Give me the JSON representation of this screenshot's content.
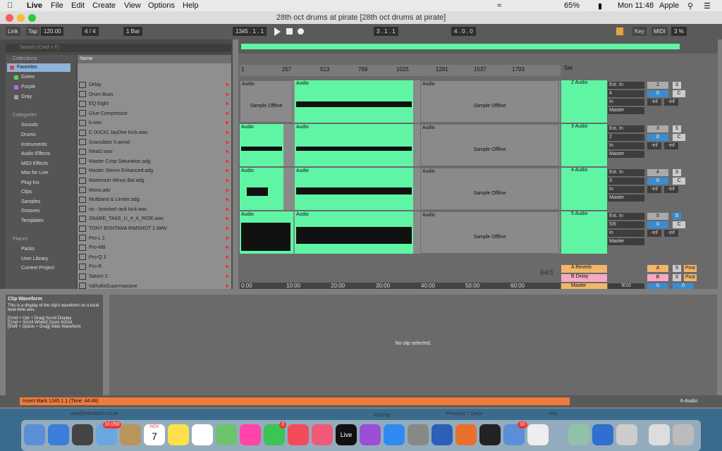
{
  "menubar": {
    "app": "Live",
    "menus": [
      "File",
      "Edit",
      "Create",
      "View",
      "Options",
      "Help"
    ],
    "battery": "65%",
    "clock": "Mon 11:48",
    "user": "Apple"
  },
  "window": {
    "title": "28th oct drums at pirate  [28th oct drums at pirate]"
  },
  "control": {
    "link": "Link",
    "tap": "Tap",
    "tempo": "120.00",
    "signature": "4 / 4",
    "quantize": "1 Bar",
    "position": "1345 .  1 .  1",
    "loop_start": "3 .  1 .  1",
    "loop_len": "4 .  0 .  0",
    "key": "Key",
    "midi": "MIDI",
    "cpu": "3 %"
  },
  "browser": {
    "search_placeholder": "Search (Cmd + F)",
    "collections_title": "Collections",
    "collections": [
      {
        "label": "Favorites",
        "color": "#e84040"
      },
      {
        "label": "Green",
        "color": "#5ad35a"
      },
      {
        "label": "Purple",
        "color": "#b46ae0"
      },
      {
        "label": "Gray",
        "color": "#a0a0a0"
      }
    ],
    "categories_title": "Categories",
    "categories": [
      "Sounds",
      "Drums",
      "Instruments",
      "Audio Effects",
      "MIDI Effects",
      "Max for Live",
      "Plug-Ins",
      "Clips",
      "Samples",
      "Grooves",
      "Templates"
    ],
    "places_title": "Places",
    "places": [
      "Packs",
      "User Library",
      "Current Project"
    ],
    "name_header": "Name",
    "files": [
      "Delay",
      "Drum Buss",
      "EQ Eight",
      "Glue Compressor",
      "b.wav",
      "C (KICK) JayDee Kick.wav",
      "Granulator II.amxd",
      "hihat2.wav",
      "Master Crisp Saturation.adg",
      "Master Stereo Enhanced.adg",
      "Maximizer Minus Bar.adg",
      "Mono.adv",
      "Multband & Limiter.adg",
      "rio - boosted rack kick.wav",
      "SNARE_TAKE_U_4_A_RIDE.wav",
      "TONY BONTANA RIMSHOT 1.WAV",
      "Pro-L 2",
      "Pro-MB",
      "Pro-Q 3",
      "Pro-R",
      "Saturn 2",
      "ValhallaSupermassive"
    ]
  },
  "arrangement": {
    "ruler": [
      "1",
      "257",
      "513",
      "769",
      "1025",
      "1281",
      "1537",
      "1793"
    ],
    "time_ruler": [
      "0:00",
      "10:00",
      "20:00",
      "30:00",
      "40:00",
      "50:00",
      "60:00"
    ],
    "set_label": "Set",
    "fraction": "64/1",
    "clip_label": "Audio",
    "offline_label": "Sample Offline",
    "tracks": [
      {
        "name": "2 Audio",
        "input": "Ext. In",
        "channel": "4",
        "monitor_in": "In",
        "monitor_auto": "Auto",
        "monitor_off": "Off",
        "out": "Master",
        "number": "2",
        "solo": "S",
        "pan": "0",
        "c": "C",
        "vol": "-inf",
        "vol2": "-inf"
      },
      {
        "name": "3 Audio",
        "input": "Ext. In",
        "channel": "2",
        "monitor_in": "In",
        "monitor_auto": "Auto",
        "monitor_off": "Off",
        "out": "Master",
        "number": "3",
        "solo": "S",
        "pan": "0",
        "c": "C",
        "vol": "-inf",
        "vol2": "-inf"
      },
      {
        "name": "4 Audio",
        "input": "Ext. In",
        "channel": "3",
        "monitor_in": "In",
        "monitor_auto": "Auto",
        "monitor_off": "Off",
        "out": "Master",
        "number": "4",
        "solo": "S",
        "pan": "0",
        "c": "C",
        "vol": "-inf",
        "vol2": "-inf"
      },
      {
        "name": "5 Audio",
        "input": "Ext. In",
        "channel": "5/6",
        "monitor_in": "In",
        "monitor_auto": "Auto",
        "monitor_off": "Off",
        "out": "Master",
        "number": "5",
        "solo": "S",
        "pan": "0",
        "c": "C",
        "vol": "-inf",
        "vol2": "-inf"
      }
    ],
    "returns": [
      {
        "name": "A Reverb",
        "letter": "A",
        "solo": "S",
        "post": "Post",
        "color": "#f2b66a"
      },
      {
        "name": "B Delay",
        "letter": "B",
        "solo": "S",
        "post": "Post",
        "color": "#f7a9c4"
      },
      {
        "name": "Master",
        "fraction": "9/10",
        "vol": "0",
        "vol2": "0",
        "color": "#f2b66a"
      }
    ]
  },
  "info": {
    "title": "Clip Waveform",
    "body": "This is a display of the clip's waveform on a local beat-time axis.",
    "hint1": "[Cmd + Opt + Drag] Scroll Display",
    "hint2": "[Cmd + Scroll Wheel] Zoom In/Out",
    "hint3": "[Shift + Option + Drag] Slide Waveform"
  },
  "detail": {
    "empty": "No clip selected."
  },
  "status": {
    "message": "Insert Mark 1345.1.1 (Time: 44:48)",
    "track": "6-Audio"
  },
  "behind": {
    "email": "max@hombach.co.uk",
    "airdrop": "AirDrop",
    "previous": "Previous 7 Days",
    "july": "July"
  },
  "dock": {
    "badge_mail": "10,050",
    "calendar_month": "NOV",
    "calendar_day": "7",
    "badge_facetime": "3",
    "badge_chrome": "10",
    "live_label": "Live"
  }
}
